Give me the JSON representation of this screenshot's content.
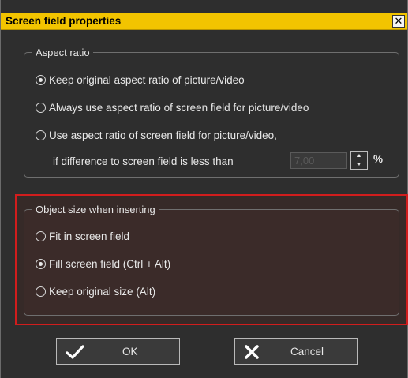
{
  "window": {
    "title": "Screen field properties",
    "close_label": "✕"
  },
  "aspect_group": {
    "legend": "Aspect ratio",
    "options": [
      {
        "label": "Keep original aspect ratio of picture/video",
        "checked": true
      },
      {
        "label": "Always use aspect ratio of screen field for picture/video",
        "checked": false
      },
      {
        "label": "Use aspect ratio of screen field for picture/video,",
        "checked": false
      }
    ],
    "threshold_label": "if difference to screen field is less than",
    "threshold_value": "7,00",
    "threshold_unit": "%"
  },
  "size_group": {
    "legend": "Object size when inserting",
    "options": [
      {
        "label": "Fit in screen field",
        "checked": false
      },
      {
        "label": "Fill screen field (Ctrl + Alt)",
        "checked": true
      },
      {
        "label": "Keep original size (Alt)",
        "checked": false
      }
    ]
  },
  "buttons": {
    "ok_label": "OK",
    "cancel_label": "Cancel"
  },
  "colors": {
    "titlebar": "#f2c400",
    "dialog_bg": "#2e2e2e",
    "highlight_border": "#d11d1d"
  }
}
